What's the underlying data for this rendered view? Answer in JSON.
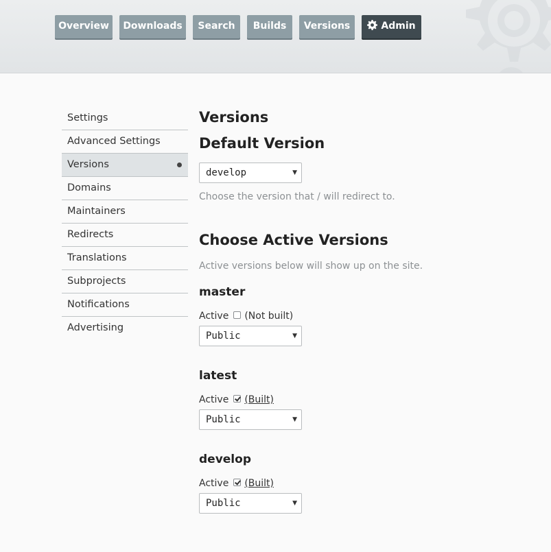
{
  "nav": {
    "tabs": [
      {
        "label": "Overview"
      },
      {
        "label": "Downloads"
      },
      {
        "label": "Search"
      },
      {
        "label": "Builds"
      },
      {
        "label": "Versions"
      },
      {
        "label": "Admin",
        "icon": "gear-icon"
      }
    ]
  },
  "sidebar": {
    "items": [
      {
        "label": "Settings"
      },
      {
        "label": "Advanced Settings"
      },
      {
        "label": "Versions",
        "active": true
      },
      {
        "label": "Domains"
      },
      {
        "label": "Maintainers"
      },
      {
        "label": "Redirects"
      },
      {
        "label": "Translations"
      },
      {
        "label": "Subprojects"
      },
      {
        "label": "Notifications"
      },
      {
        "label": "Advertising"
      }
    ]
  },
  "main": {
    "title": "Versions",
    "default_version": {
      "heading": "Default Version",
      "selected": "develop",
      "help": "Choose the version that / will redirect to."
    },
    "active_versions": {
      "heading": "Choose Active Versions",
      "help": "Active versions below will show up on the site.",
      "versions": [
        {
          "name": "master",
          "active_label": "Active",
          "checked": false,
          "status": "(Not built)",
          "privacy": "Public"
        },
        {
          "name": "latest",
          "active_label": "Active",
          "checked": true,
          "status": "(Built)",
          "privacy": "Public"
        },
        {
          "name": "develop",
          "active_label": "Active",
          "checked": true,
          "status": "(Built)",
          "privacy": "Public"
        }
      ]
    }
  },
  "colors": {
    "tab_bg": "#8e9ea5",
    "tab_active_bg": "#3f4a50",
    "sidebar_active_bg": "#dfe3e5",
    "help_text": "#8c9093"
  }
}
